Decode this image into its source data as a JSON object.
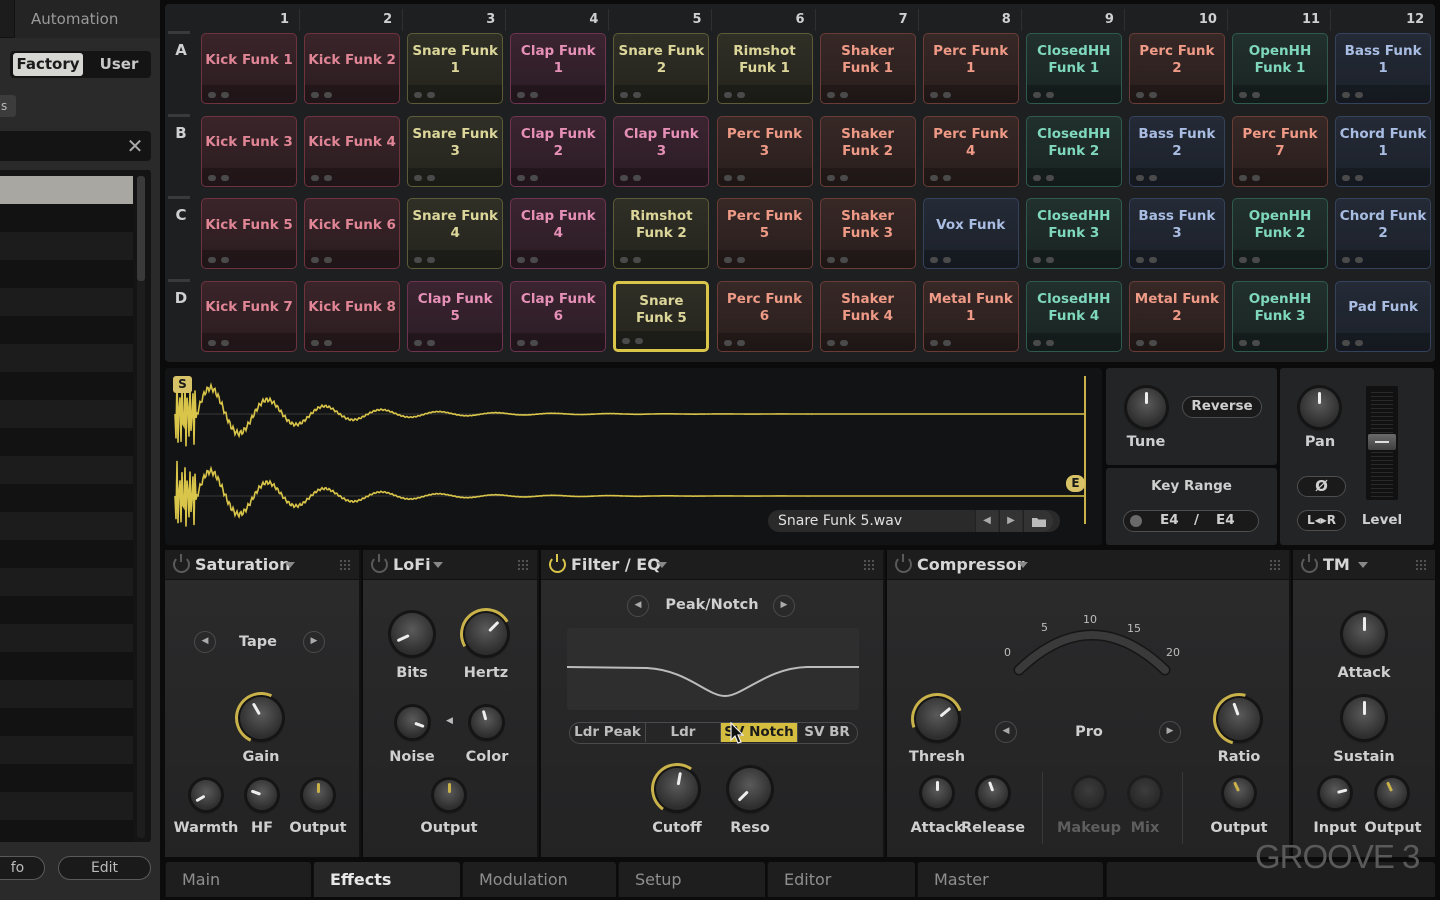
{
  "sidebar": {
    "tab_label": "Automation",
    "segment": {
      "factory": "Factory",
      "user": "User",
      "selected": "Factory"
    },
    "chip_label": "s",
    "search": {
      "value": "",
      "clear_icon": "close-icon"
    },
    "buttons": {
      "info": "fo",
      "edit": "Edit"
    }
  },
  "grid": {
    "columns": [
      "1",
      "2",
      "3",
      "4",
      "5",
      "6",
      "7",
      "8",
      "9",
      "10",
      "11",
      "12"
    ],
    "rows": [
      {
        "label": "A",
        "pads": [
          {
            "name": "Kick Funk 1",
            "color": "red"
          },
          {
            "name": "Kick Funk 2",
            "color": "red"
          },
          {
            "name": "Snare Funk 1",
            "color": "olive"
          },
          {
            "name": "Clap Funk 1",
            "color": "pink"
          },
          {
            "name": "Snare Funk 2",
            "color": "olive"
          },
          {
            "name": "Rimshot Funk 1",
            "color": "olive"
          },
          {
            "name": "Shaker Funk 1",
            "color": "salmon"
          },
          {
            "name": "Perc Funk 1",
            "color": "salmon"
          },
          {
            "name": "ClosedHH Funk 1",
            "color": "teal"
          },
          {
            "name": "Perc Funk 2",
            "color": "salmon"
          },
          {
            "name": "OpenHH Funk 1",
            "color": "teal"
          },
          {
            "name": "Bass Funk 1",
            "color": "blue"
          }
        ]
      },
      {
        "label": "B",
        "pads": [
          {
            "name": "Kick Funk 3",
            "color": "red"
          },
          {
            "name": "Kick Funk 4",
            "color": "red"
          },
          {
            "name": "Snare Funk 3",
            "color": "olive"
          },
          {
            "name": "Clap Funk 2",
            "color": "pink"
          },
          {
            "name": "Clap Funk 3",
            "color": "pink"
          },
          {
            "name": "Perc Funk 3",
            "color": "salmon"
          },
          {
            "name": "Shaker Funk 2",
            "color": "salmon"
          },
          {
            "name": "Perc Funk 4",
            "color": "salmon"
          },
          {
            "name": "ClosedHH Funk 2",
            "color": "teal"
          },
          {
            "name": "Bass Funk 2",
            "color": "blue"
          },
          {
            "name": "Perc Funk 7",
            "color": "salmon"
          },
          {
            "name": "Chord Funk 1",
            "color": "blue"
          }
        ]
      },
      {
        "label": "C",
        "pads": [
          {
            "name": "Kick Funk 5",
            "color": "red"
          },
          {
            "name": "Kick Funk 6",
            "color": "red"
          },
          {
            "name": "Snare Funk 4",
            "color": "olive"
          },
          {
            "name": "Clap Funk 4",
            "color": "pink"
          },
          {
            "name": "Rimshot Funk 2",
            "color": "olive"
          },
          {
            "name": "Perc Funk 5",
            "color": "salmon"
          },
          {
            "name": "Shaker Funk 3",
            "color": "salmon"
          },
          {
            "name": "Vox Funk",
            "color": "blue"
          },
          {
            "name": "ClosedHH Funk 3",
            "color": "teal"
          },
          {
            "name": "Bass Funk 3",
            "color": "blue"
          },
          {
            "name": "OpenHH Funk 2",
            "color": "teal"
          },
          {
            "name": "Chord Funk 2",
            "color": "blue"
          }
        ]
      },
      {
        "label": "D",
        "pads": [
          {
            "name": "Kick Funk 7",
            "color": "red"
          },
          {
            "name": "Kick Funk 8",
            "color": "red"
          },
          {
            "name": "Clap Funk 5",
            "color": "pink"
          },
          {
            "name": "Clap Funk 6",
            "color": "pink"
          },
          {
            "name": "Snare Funk 5",
            "color": "olive",
            "selected": true
          },
          {
            "name": "Perc Funk 6",
            "color": "salmon"
          },
          {
            "name": "Shaker Funk 4",
            "color": "salmon"
          },
          {
            "name": "Metal Funk 1",
            "color": "salmon"
          },
          {
            "name": "ClosedHH Funk 4",
            "color": "teal"
          },
          {
            "name": "Metal Funk 2",
            "color": "salmon"
          },
          {
            "name": "OpenHH Funk 3",
            "color": "teal"
          },
          {
            "name": "Pad Funk",
            "color": "blue"
          }
        ]
      }
    ]
  },
  "sample": {
    "start_marker": "S",
    "end_marker": "E",
    "file_name": "Snare Funk 5.wav",
    "prev_icon": "chevron-left-icon",
    "next_icon": "chevron-right-icon",
    "folder_icon": "folder-icon",
    "waveform_color": "#d9c54a",
    "tune_label": "Tune",
    "reverse_label": "Reverse",
    "key_range_label": "Key Range",
    "key_low": "E4",
    "key_sep": "/",
    "key_high": "E4",
    "pan_label": "Pan",
    "phase_label": "Ø",
    "lr_label": "L◂▸R",
    "level_label": "Level"
  },
  "effects": [
    {
      "id": "saturation",
      "title": "Saturation",
      "on": false,
      "mode": "Tape",
      "knobs": {
        "gain": "Gain",
        "warmth": "Warmth",
        "hf": "HF",
        "output": "Output"
      }
    },
    {
      "id": "lofi",
      "title": "LoFi",
      "on": false,
      "knobs": {
        "bits": "Bits",
        "hertz": "Hertz",
        "noise": "Noise",
        "color": "Color",
        "output": "Output"
      }
    },
    {
      "id": "filter",
      "title": "Filter / EQ",
      "on": true,
      "mode": "Peak/Notch",
      "types": [
        "Ldr Peak",
        "Ldr Notch",
        "SV Notch",
        "SV BR"
      ],
      "selected_type": "SV Notch",
      "knobs": {
        "cutoff": "Cutoff",
        "reso": "Reso"
      }
    },
    {
      "id": "compressor",
      "title": "Compressor",
      "on": false,
      "mode": "Pro",
      "meter_ticks": [
        "0",
        "5",
        "10",
        "15",
        "20"
      ],
      "knobs": {
        "thresh": "Thresh",
        "ratio": "Ratio",
        "attack": "Attack",
        "release": "Release",
        "makeup": "Makeup",
        "mix": "Mix",
        "output": "Output"
      }
    },
    {
      "id": "tm",
      "title": "TM",
      "on": false,
      "knobs": {
        "attack": "Attack",
        "sustain": "Sustain",
        "input": "Input",
        "output": "Output"
      }
    }
  ],
  "bottom_tabs": [
    "Main",
    "Effects",
    "Modulation",
    "Setup",
    "Editor",
    "Master"
  ],
  "active_tab": "Effects",
  "watermark": "GROOVE 3",
  "colors": {
    "accent": "#d9c54a",
    "background": "#0b0b0b",
    "panel": "#232425"
  }
}
